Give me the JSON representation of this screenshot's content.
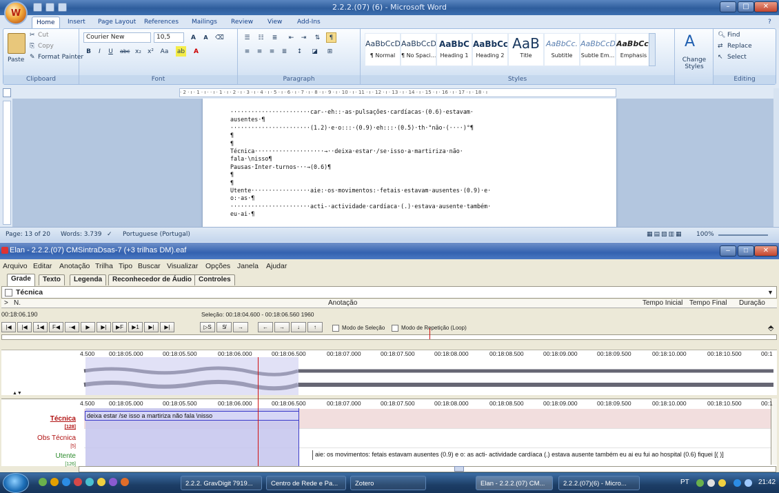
{
  "word": {
    "title": "2.2.2.(07) (6) - Microsoft Word",
    "office_button": "W",
    "tabs": [
      "Home",
      "Insert",
      "Page Layout",
      "References",
      "Mailings",
      "Review",
      "View",
      "Add-Ins"
    ],
    "clipboard": {
      "paste": "Paste",
      "cut": "Cut",
      "copy": "Copy",
      "format_painter": "Format Painter",
      "label": "Clipboard"
    },
    "font": {
      "name": "Courier New",
      "size": "10,5",
      "label": "Font"
    },
    "paragraph_label": "Paragraph",
    "styles": [
      {
        "preview": "AaBbCcDc",
        "name": "¶ Normal"
      },
      {
        "preview": "AaBbCcDc",
        "name": "¶ No Spaci..."
      },
      {
        "preview": "AaBbC",
        "name": "Heading 1"
      },
      {
        "preview": "AaBbCc",
        "name": "Heading 2"
      },
      {
        "preview": "AaB",
        "name": "Title"
      },
      {
        "preview": "AaBbCc.",
        "name": "Subtitle"
      },
      {
        "preview": "AaBbCcDc",
        "name": "Subtle Em..."
      },
      {
        "preview": "AaBbCcDc",
        "name": "Emphasis"
      }
    ],
    "styles_label": "Styles",
    "change_styles": "Change Styles",
    "editing": {
      "find": "Find",
      "replace": "Replace",
      "select": "Select",
      "label": "Editing"
    },
    "ruler_text": "· 2 · ı · 1 · ı ·    · ı · 1 · ı · 2 · ı · 3 · ı · 4 · ı · 5 · ı · 6 · ı · 7 · ı · 8 · ı · 9 · ı · 10 · ı · 11 · ı · 12 · ı · 13 · ı · 14 · ı · 15 · ı · 16 · ı · 17 · ı · 18 · ı",
    "doc_lines": [
      "·······················car-·eh::·as·pulsações·cardíacas·(0.6)·estavam·",
      "ausentes·¶",
      "·······················(1.2)·e·o:::·(0.9)·eh:::·(0.5)·th·°não·(····)°¶",
      "¶",
      "¶",
      "Técnica····················→··deixa·estar·/se·isso·a·martiriza·não·",
      "fala·\\nisso¶",
      "Pausas·Inter-turnos···→(0.6)¶",
      "¶",
      "¶",
      "Utente·················aie:·os·movimentos:·fetais·estavam·ausentes·(0.9)·e·",
      "o:·as·¶",
      "·······················acti-·actividade·cardíaca·(.)·estava·ausente·também·",
      "eu·ai·¶"
    ],
    "status": {
      "page": "Page: 13 of 20",
      "words": "Words: 3.739",
      "language": "Portuguese (Portugal)",
      "zoom": "100%"
    }
  },
  "elan": {
    "title": "Elan - 2.2.2.(07) CMSintraDsas-7 (+3 trilhas DM).eaf",
    "menu": [
      "Arquivo",
      "Editar",
      "Anotação",
      "Trilha",
      "Tipo",
      "Buscar",
      "Visualizar",
      "Opções",
      "Janela",
      "Ajudar"
    ],
    "tabs": [
      "Grade",
      "Texto",
      "Legenda",
      "Reconhecedor de Áudio",
      "Controles"
    ],
    "tier_selected": "Técnica",
    "columns": {
      "n": "N.",
      "annotation": "Anotação",
      "start": "Tempo Inicial",
      "end": "Tempo Final",
      "duration": "Duração"
    },
    "current_time": "00:18:06.190",
    "selection": "Seleção: 00:18:04.600 - 00:18:06.560  1960",
    "media_buttons": [
      "|◀",
      "|◀",
      "1◀",
      "F◀",
      "-◀",
      "▶",
      "▶|",
      "▶F",
      "▶1",
      "▶|",
      "▶|"
    ],
    "sel_buttons": [
      "▷S",
      "S̸",
      "→"
    ],
    "nav_buttons": [
      "←",
      "→",
      "↓",
      "↑"
    ],
    "mode_selection": "Modo de Seleção",
    "mode_loop": "Modo de Repetição (Loop)",
    "ticks": [
      "4.500",
      "00:18:05.000",
      "00:18:05.500",
      "00:18:06.000",
      "00:18:06.500",
      "00:18:07.000",
      "00:18:07.500",
      "00:18:08.000",
      "00:18:08.500",
      "00:18:09.000",
      "00:18:09.500",
      "00:18:10.000",
      "00:18:10.500",
      "00:1"
    ],
    "tiers": [
      {
        "name": "Técnica",
        "count": "[128]",
        "annotation": "deixa estar /se isso a martiriza não fala \\nisso"
      },
      {
        "name": "Obs Técnica",
        "count": "[5]",
        "annotation": ""
      },
      {
        "name": "Utente",
        "count": "[126]",
        "annotation": "aie: os movimentos: fetais estavam ausentes (0.9) e o: as acti- actividade cardíaca (.) estava ausente também eu ai eu fui ao hospital (0.6) fiquei [(   )]"
      }
    ]
  },
  "taskbar": {
    "items": [
      "2.2.2. GravDigit 7919...",
      "Centro de Rede e Pa...",
      "Zotero",
      "Elan - 2.2.2.(07) CM...",
      "2.2.2.(07)(6) - Micro..."
    ],
    "lang": "PT",
    "clock": "21:42"
  }
}
